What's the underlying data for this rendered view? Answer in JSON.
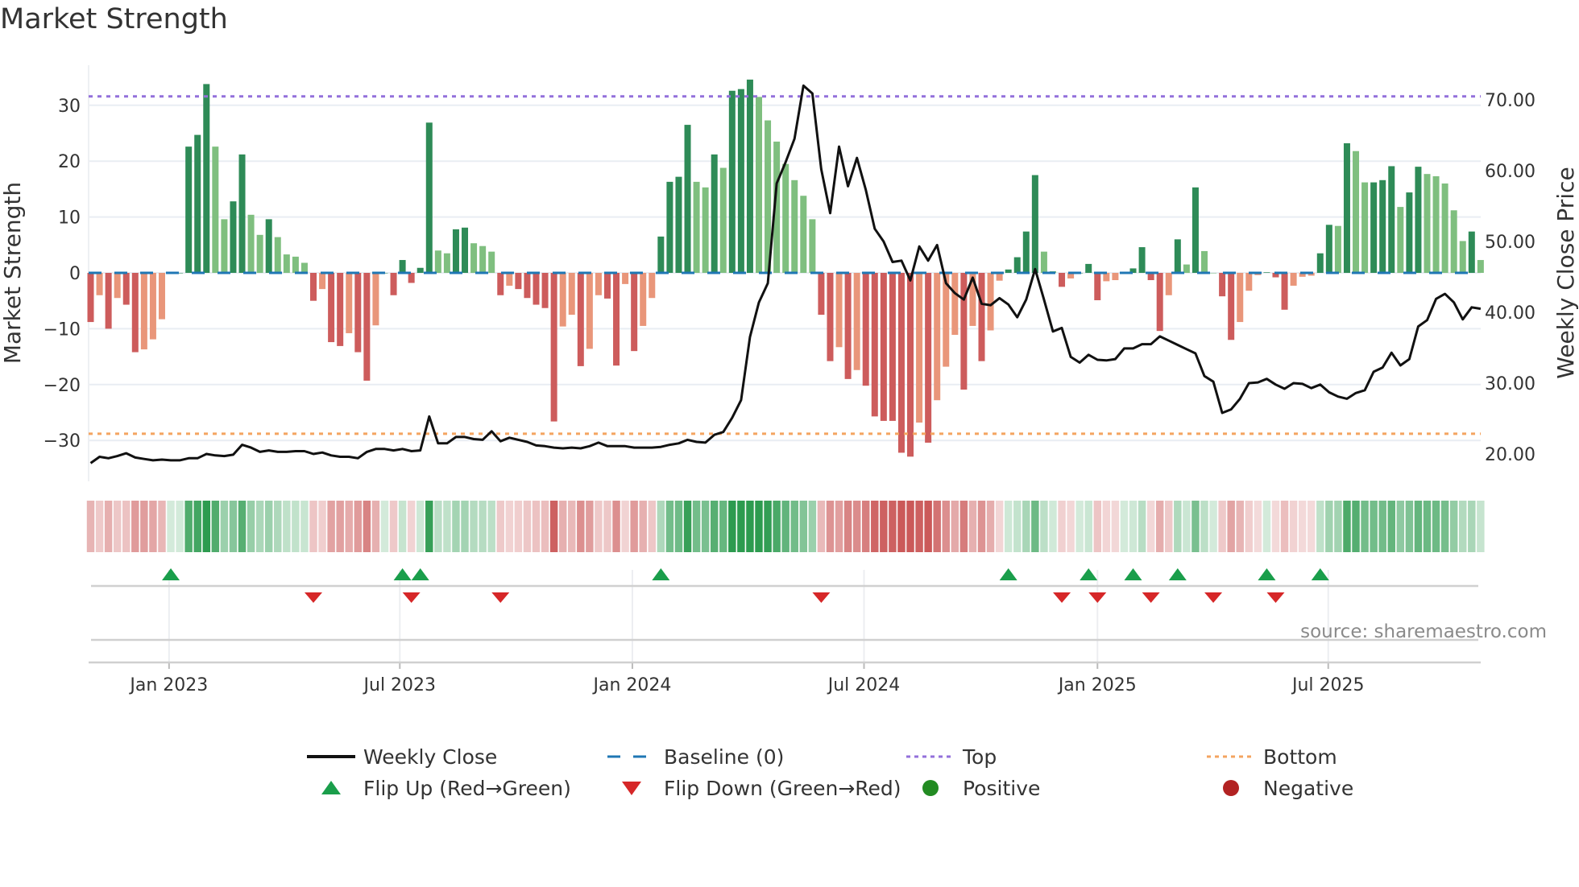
{
  "chart_data": {
    "type": "bar+line",
    "title": "Market Strength",
    "ylabel": "Market Strength",
    "y2label": "Weekly Close Price",
    "ylim": [
      -35,
      37
    ],
    "y2lim": [
      15,
      72
    ],
    "yticks": [
      "30",
      "20",
      "10",
      "0",
      "−10",
      "−20",
      "−30"
    ],
    "ytick_values": [
      30,
      20,
      10,
      0,
      -10,
      -20,
      -30
    ],
    "y2ticks": [
      "70.00",
      "60.00",
      "50.00",
      "40.00",
      "30.00",
      "20.00"
    ],
    "y2tick_values": [
      70,
      60,
      50,
      40,
      30,
      20
    ],
    "xticks": [
      "Jan 2023",
      "Jul 2023",
      "Jan 2024",
      "Jul 2024",
      "Jan 2025",
      "Jul 2025"
    ],
    "xtick_week_index": [
      8.8,
      34.7,
      60.8,
      86.8,
      113,
      138.9
    ],
    "frequency": "weekly",
    "top_level": 31.6,
    "bottom_level": -28.8,
    "baseline": 0,
    "strength": [
      -8.8,
      -4,
      -10,
      -4.5,
      -5.7,
      -14.2,
      -13.7,
      -11.9,
      -8.3,
      0,
      0,
      22.6,
      24.7,
      33.8,
      22.6,
      9.6,
      12.8,
      21.2,
      10.4,
      6.8,
      9.6,
      6.4,
      3.3,
      2.9,
      1.8,
      -5,
      -2.9,
      -12.4,
      -13.1,
      -10.8,
      -14.2,
      -19.3,
      -9.4,
      0,
      -4,
      2.3,
      -1.8,
      0.9,
      26.9,
      4,
      3.5,
      7.8,
      8.1,
      5.3,
      4.8,
      3.8,
      -4,
      -2.3,
      -2.9,
      -4.5,
      -5.7,
      -6.3,
      -26.6,
      -9.6,
      -7.5,
      -16.7,
      -13.6,
      -4,
      -4.6,
      -16.6,
      -2,
      -14,
      -9.5,
      -4.5,
      6.5,
      16.3,
      17.2,
      26.5,
      16.3,
      15.3,
      21.2,
      18.8,
      32.6,
      32.9,
      34.6,
      31.5,
      27.3,
      23.5,
      19.5,
      16.6,
      13.8,
      9.6,
      -7.5,
      -15.8,
      -13.3,
      -19,
      -17.4,
      -20.2,
      -25.7,
      -26.5,
      -26.5,
      -32.2,
      -32.9,
      -26.8,
      -30.4,
      -22.8,
      -16.8,
      -11.1,
      -20.9,
      -9.5,
      -15.8,
      -10.3,
      -1.4,
      0.6,
      2.8,
      7.4,
      17.5,
      3.8,
      0.3,
      -2.5,
      -1,
      0,
      1.6,
      -4.9,
      -1.5,
      -1.3,
      0,
      0.8,
      4.6,
      -1.3,
      -10.4,
      -4,
      6,
      1.5,
      15.3,
      3.9,
      0,
      -4.2,
      -12,
      -8.8,
      -3.2,
      -0.4,
      0.1,
      -0.8,
      -6.6,
      -2.3,
      -0.7,
      -0.5,
      3.5,
      8.6,
      8.4,
      23.2,
      21.8,
      16.2,
      16.2,
      16.6,
      19.1,
      11.8,
      14.4,
      19,
      17.7,
      17.3,
      16,
      11.2,
      5.7,
      7.4,
      2.3
    ],
    "weekly_close": [
      18.7,
      19.6,
      19.4,
      19.7,
      20.1,
      19.5,
      19.3,
      19.1,
      19.2,
      19.1,
      19.1,
      19.4,
      19.4,
      20.0,
      19.8,
      19.7,
      19.9,
      21.3,
      20.9,
      20.3,
      20.5,
      20.3,
      20.3,
      20.4,
      20.4,
      20.0,
      20.2,
      19.8,
      19.6,
      19.6,
      19.4,
      20.3,
      20.7,
      20.7,
      20.5,
      20.7,
      20.4,
      20.5,
      25.3,
      21.5,
      21.5,
      22.4,
      22.4,
      22.1,
      22.0,
      23.2,
      21.8,
      22.3,
      22.0,
      21.7,
      21.2,
      21.1,
      20.9,
      20.8,
      20.9,
      20.8,
      21.1,
      21.6,
      21.1,
      21.1,
      21.1,
      20.9,
      20.9,
      20.9,
      21.0,
      21.3,
      21.5,
      22.0,
      21.7,
      21.6,
      22.7,
      23.1,
      25.1,
      27.6,
      36.5,
      41.4,
      44.1,
      58.2,
      61.2,
      64.5,
      72.0,
      70.9,
      60.2,
      54.0,
      63.4,
      57.8,
      61.8,
      57.3,
      51.8,
      50.0,
      47.1,
      47.3,
      44.5,
      49.3,
      47.3,
      49.5,
      44.1,
      42.7,
      41.8,
      44.9,
      41.2,
      41.0,
      42.0,
      41.1,
      39.3,
      41.8,
      46.1,
      41.8,
      37.3,
      37.8,
      33.7,
      32.9,
      34.0,
      33.3,
      33.2,
      33.4,
      34.9,
      34.9,
      35.5,
      35.5,
      36.6,
      36.0,
      35.4,
      34.8,
      34.2,
      31.0,
      30.2,
      25.8,
      26.3,
      27.8,
      30.0,
      30.1,
      30.6,
      29.8,
      29.2,
      30.0,
      29.9,
      29.3,
      29.8,
      28.7,
      28.1,
      27.8,
      28.6,
      29.0,
      31.6,
      32.2,
      34.3,
      32.5,
      33.4,
      38.0,
      38.9,
      41.9,
      42.6,
      41.4,
      39.0,
      40.7,
      40.5
    ],
    "flip_up_week_index": [
      9,
      35,
      37,
      64,
      103,
      112,
      117,
      122,
      132,
      138
    ],
    "flip_down_week_index": [
      25,
      36,
      46,
      82,
      109,
      113,
      119,
      126,
      133
    ],
    "legend": {
      "placement": "bottom",
      "items": [
        {
          "label": "Weekly Close",
          "symbol": "line",
          "color": "#111111"
        },
        {
          "label": "Baseline (0)",
          "symbol": "dash",
          "color": "#1f77b4"
        },
        {
          "label": "Top",
          "symbol": "dot",
          "color": "#9370db"
        },
        {
          "label": "Bottom",
          "symbol": "dot",
          "color": "#f4a460"
        },
        {
          "label": "Flip Up (Red→Green)",
          "symbol": "triangle-up",
          "color": "#1a9e4b"
        },
        {
          "label": "Flip Down (Green→Red)",
          "symbol": "triangle-down",
          "color": "#d62728"
        },
        {
          "label": "Positive",
          "symbol": "circle",
          "color": "#228b22"
        },
        {
          "label": "Negative",
          "symbol": "circle",
          "color": "#b22222"
        }
      ]
    },
    "colors": {
      "pos_rising": "#2e8b57",
      "pos_falling": "#7fbf7f",
      "neg_falling": "#cd5c5c",
      "neg_rising": "#e9967a",
      "top": "#9370db",
      "bottom": "#f4a460",
      "baseline": "#1f77b4",
      "strip_pos": "34,150,70",
      "strip_neg": "200,80,80"
    }
  },
  "source": "source: sharemaestro.com"
}
